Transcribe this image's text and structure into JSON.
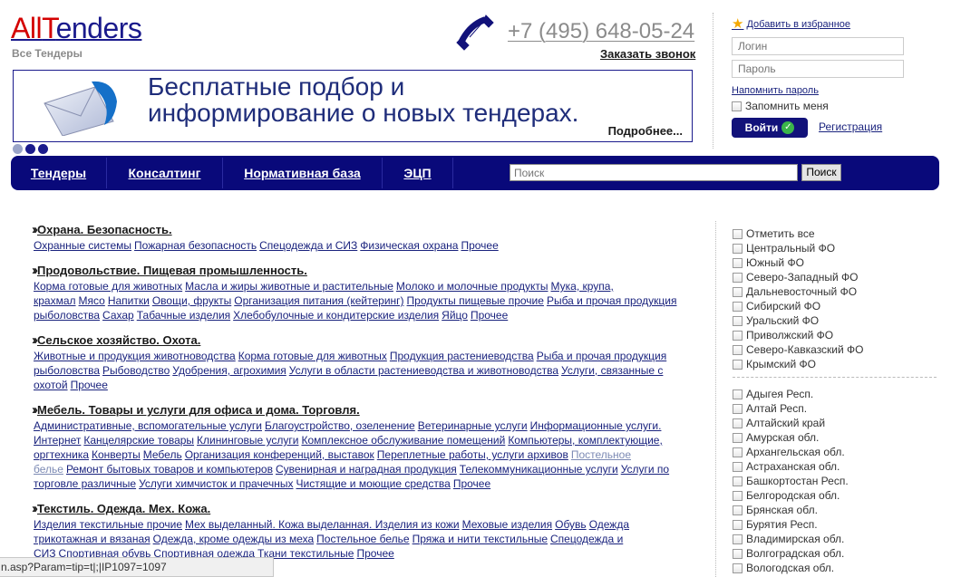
{
  "logo": {
    "part1": "All",
    "part2": "T",
    "part3": "enders",
    "subtitle": "Все Тендеры"
  },
  "phone": {
    "number": "+7 (495) 648-05-24",
    "callback": "Заказать звонок"
  },
  "banner": {
    "line1": "Бесплатные подбор и",
    "line2": "информирование о новых тендерах.",
    "more": "Подробнее..."
  },
  "login": {
    "favorite": "Добавить в избранное",
    "login_placeholder": "Логин",
    "password_placeholder": "Пароль",
    "remind": "Напомнить пароль",
    "remember": "Запомнить меня",
    "submit": "Войти",
    "register": "Регистрация"
  },
  "nav": {
    "items": [
      "Тендеры",
      "Консалтинг",
      "Нормативная база",
      "ЭЦП"
    ],
    "search_placeholder": "Поиск",
    "search_button": "Поиск"
  },
  "categories": [
    {
      "title": "Охрана. Безопасность.",
      "links": [
        "Охранные системы",
        "Пожарная безопасность",
        "Спецодежда и СИЗ",
        "Физическая охрана",
        "Прочее"
      ]
    },
    {
      "title": "Продовольствие. Пищевая промышленность.",
      "links": [
        "Корма готовые для животных",
        "Масла и жиры животные и растительные",
        "Молоко и молочные продукты",
        "Мука, крупа, крахмал",
        "Мясо",
        "Напитки",
        "Овощи, фрукты",
        "Организация питания (кейтеринг)",
        "Продукты пищевые прочие",
        "Рыба и прочая продукция рыболовства",
        "Сахар",
        "Табачные изделия",
        "Хлебобулочные и кондитерские изделия",
        "Яйцо",
        "Прочее"
      ]
    },
    {
      "title": "Сельское хозяйство. Охота.",
      "links": [
        "Животные и продукция животноводства",
        "Корма готовые для животных",
        "Продукция растениеводства",
        "Рыба и прочая продукция рыболовства",
        "Рыбоводство",
        "Удобрения, агрохимия",
        "Услуги в области растениеводства и животноводства",
        "Услуги, связанные с охотой",
        "Прочее"
      ]
    },
    {
      "title": "Мебель. Товары и услуги для офиса и дома. Торговля.",
      "links": [
        "Административные, вспомогательные услуги",
        "Благоустройство, озеленение",
        "Ветеринарные услуги",
        "Информационные услуги. Интернет",
        "Канцелярские товары",
        "Клининговые услуги",
        "Комплексное обслуживание помещений",
        "Компьютеры, комплектующие, оргтехника",
        "Конверты",
        "Мебель",
        "Организация конференций, выставок",
        "Переплетные работы, услуги архивов",
        "Постельное белье",
        "Ремонт бытовых товаров и компьютеров",
        "Сувенирная и наградная продукция",
        "Телекоммуникационные услуги",
        "Услуги по торговле различные",
        "Услуги химчисток и прачечных",
        "Чистящие и моющие средства",
        "Прочее"
      ]
    },
    {
      "title": "Текстиль. Одежда. Мех. Кожа.",
      "links": [
        "Изделия текстильные прочие",
        "Мех выделанный. Кожа выделанная. Изделия из кожи",
        "Меховые изделия",
        "Обувь",
        "Одежда трикотажная и вязаная",
        "Одежда, кроме одежды из меха",
        "Постельное белье",
        "Пряжа и нити текстильные",
        "Спецодежда и СИЗ",
        "Спортивная обувь",
        "Спортивная одежда",
        "Ткани текстильные",
        "Прочее"
      ]
    }
  ],
  "filters": {
    "districts": [
      "Отметить все",
      "Центральный ФО",
      "Южный ФО",
      "Северо-Западный ФО",
      "Дальневосточный ФО",
      "Сибирский ФО",
      "Уральский ФО",
      "Приволжский ФО",
      "Северо-Кавказский ФО",
      "Крымский ФО"
    ],
    "regions": [
      "Адыгея Респ.",
      "Алтай Респ.",
      "Алтайский край",
      "Амурская обл.",
      "Архангельская обл.",
      "Астраханская обл.",
      "Башкортостан Респ.",
      "Белгородская обл.",
      "Брянская обл.",
      "Бурятия Респ.",
      "Владимирская обл.",
      "Волгоградская обл.",
      "Вологодская обл."
    ]
  },
  "statusbar": {
    "url": "n.asp?Param=tip=t|;|IP1097=1097"
  },
  "colors": {
    "brand_blue": "#09097a",
    "logo_red": "#d40000",
    "link": "#1a237e"
  }
}
